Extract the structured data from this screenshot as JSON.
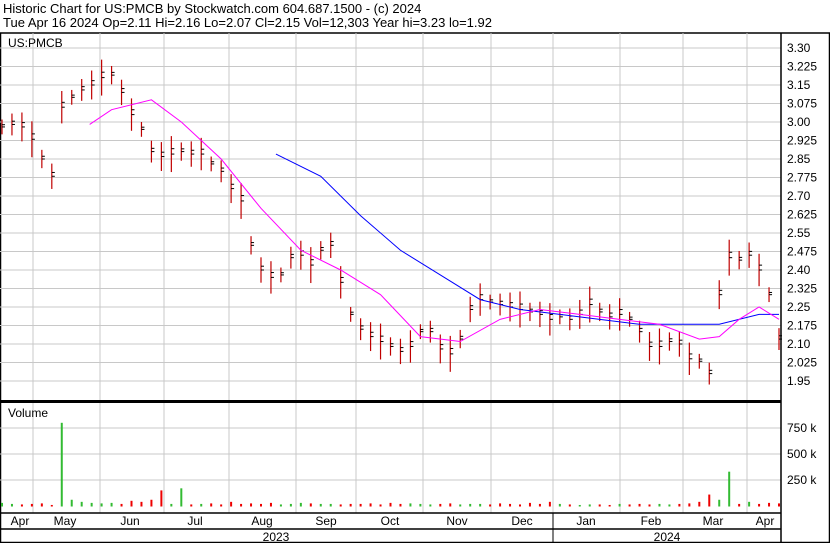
{
  "header": {
    "line1": "Historic Chart for US:PMCB by Stockwatch.com 604.687.1500 - (c) 2024",
    "line2": "Tue Apr 16 2024  Op=2.11  Hi=2.16  Lo=2.07  Cl=2.15  Vol=12,303  Year hi=3.23  lo=1.92"
  },
  "chart_data": {
    "type": "line",
    "title": "US:PMCB",
    "volume_label": "Volume",
    "ylim": [
      1.9,
      3.33
    ],
    "y_ticks": [
      "3.30",
      "3.225",
      "3.15",
      "3.075",
      "3.00",
      "2.925",
      "2.85",
      "2.775",
      "2.70",
      "2.625",
      "2.55",
      "2.475",
      "2.40",
      "2.325",
      "2.25",
      "2.175",
      "2.10",
      "2.025",
      "1.95"
    ],
    "vol_ticks": [
      "750 k",
      "500 k",
      "250 k"
    ],
    "months": [
      "Apr",
      "May",
      "Jun",
      "Jul",
      "Aug",
      "Sep",
      "Oct",
      "Nov",
      "Dec",
      "Jan",
      "Feb",
      "Mar",
      "Apr"
    ],
    "years": [
      "2023",
      "2024"
    ],
    "close": [
      2.98,
      2.99,
      2.98,
      2.93,
      2.85,
      2.78,
      3.06,
      3.1,
      3.13,
      3.15,
      3.18,
      3.19,
      3.12,
      3.03,
      2.97,
      2.88,
      2.86,
      2.87,
      2.88,
      2.87,
      2.87,
      2.83,
      2.8,
      2.73,
      2.68,
      2.5,
      2.4,
      2.37,
      2.38,
      2.45,
      2.46,
      2.42,
      2.48,
      2.5,
      2.35,
      2.22,
      2.16,
      2.13,
      2.11,
      2.09,
      2.07,
      2.09,
      2.15,
      2.15,
      2.08,
      2.06,
      2.12,
      2.24,
      2.28,
      2.27,
      2.26,
      2.25,
      2.24,
      2.23,
      2.22,
      2.2,
      2.21,
      2.2,
      2.22,
      2.26,
      2.23,
      2.21,
      2.22,
      2.2,
      2.15,
      2.09,
      2.09,
      2.11,
      2.1,
      2.04,
      2.03,
      1.98,
      2.3,
      2.45,
      2.44,
      2.46,
      2.4,
      2.3,
      2.12
    ],
    "volume_k": [
      30,
      20,
      15,
      20,
      25,
      10,
      800,
      60,
      40,
      30,
      25,
      30,
      20,
      50,
      40,
      60,
      150,
      20,
      170,
      15,
      20,
      25,
      15,
      40,
      20,
      25,
      20,
      30,
      15,
      20,
      30,
      25,
      20,
      20,
      15,
      20,
      20,
      25,
      15,
      30,
      20,
      25,
      20,
      15,
      20,
      25,
      15,
      20,
      20,
      15,
      25,
      20,
      15,
      30,
      20,
      40,
      20,
      15,
      10,
      15,
      15,
      10,
      20,
      15,
      20,
      15,
      20,
      15,
      20,
      25,
      40,
      110,
      60,
      330,
      20,
      40,
      20,
      30,
      25
    ],
    "ma_long": [
      [
        27.5,
        2.87
      ],
      [
        32,
        2.78
      ],
      [
        36,
        2.62
      ],
      [
        40,
        2.48
      ],
      [
        44,
        2.38
      ],
      [
        48,
        2.28
      ],
      [
        52,
        2.24
      ],
      [
        56,
        2.22
      ],
      [
        60,
        2.2
      ],
      [
        64,
        2.18
      ],
      [
        68,
        2.18
      ],
      [
        72,
        2.18
      ],
      [
        76,
        2.22
      ],
      [
        78,
        2.22
      ]
    ],
    "ma_short": [
      [
        8.8,
        2.99
      ],
      [
        11,
        3.05
      ],
      [
        15,
        3.09
      ],
      [
        18,
        3.0
      ],
      [
        22,
        2.85
      ],
      [
        26,
        2.65
      ],
      [
        30,
        2.48
      ],
      [
        34,
        2.4
      ],
      [
        38,
        2.3
      ],
      [
        42,
        2.13
      ],
      [
        46,
        2.11
      ],
      [
        50,
        2.2
      ],
      [
        54,
        2.24
      ],
      [
        58,
        2.22
      ],
      [
        62,
        2.2
      ],
      [
        66,
        2.18
      ],
      [
        70,
        2.12
      ],
      [
        72,
        2.13
      ],
      [
        74,
        2.2
      ],
      [
        76,
        2.25
      ],
      [
        78,
        2.2
      ]
    ],
    "colors": {
      "bar": "#c00000",
      "ma_long": "#0000ff",
      "ma_short": "#ff00ff",
      "vol_up": "#33bb33",
      "vol_down": "#ee0000",
      "grid": "#c8c8c8"
    }
  }
}
